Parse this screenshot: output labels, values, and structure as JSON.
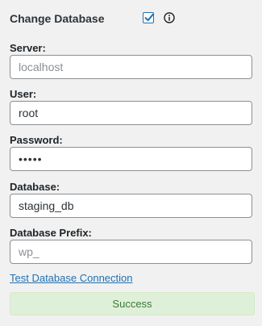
{
  "header": {
    "title": "Change Database",
    "checkbox_checked": true,
    "info_icon": "info-icon"
  },
  "fields": {
    "server": {
      "label": "Server:",
      "value": "",
      "placeholder": "localhost"
    },
    "user": {
      "label": "User:",
      "value": "root"
    },
    "password": {
      "label": "Password:",
      "value": "•••••"
    },
    "database": {
      "label": "Database:",
      "value": "staging_db"
    },
    "prefix": {
      "label": "Database Prefix:",
      "value": "",
      "placeholder": "wp_"
    }
  },
  "test_link": "Test Database Connection",
  "status": {
    "text": "Success",
    "color": "#dff0d8"
  },
  "colors": {
    "accent": "#2271b1",
    "success_text": "#3c763d"
  }
}
